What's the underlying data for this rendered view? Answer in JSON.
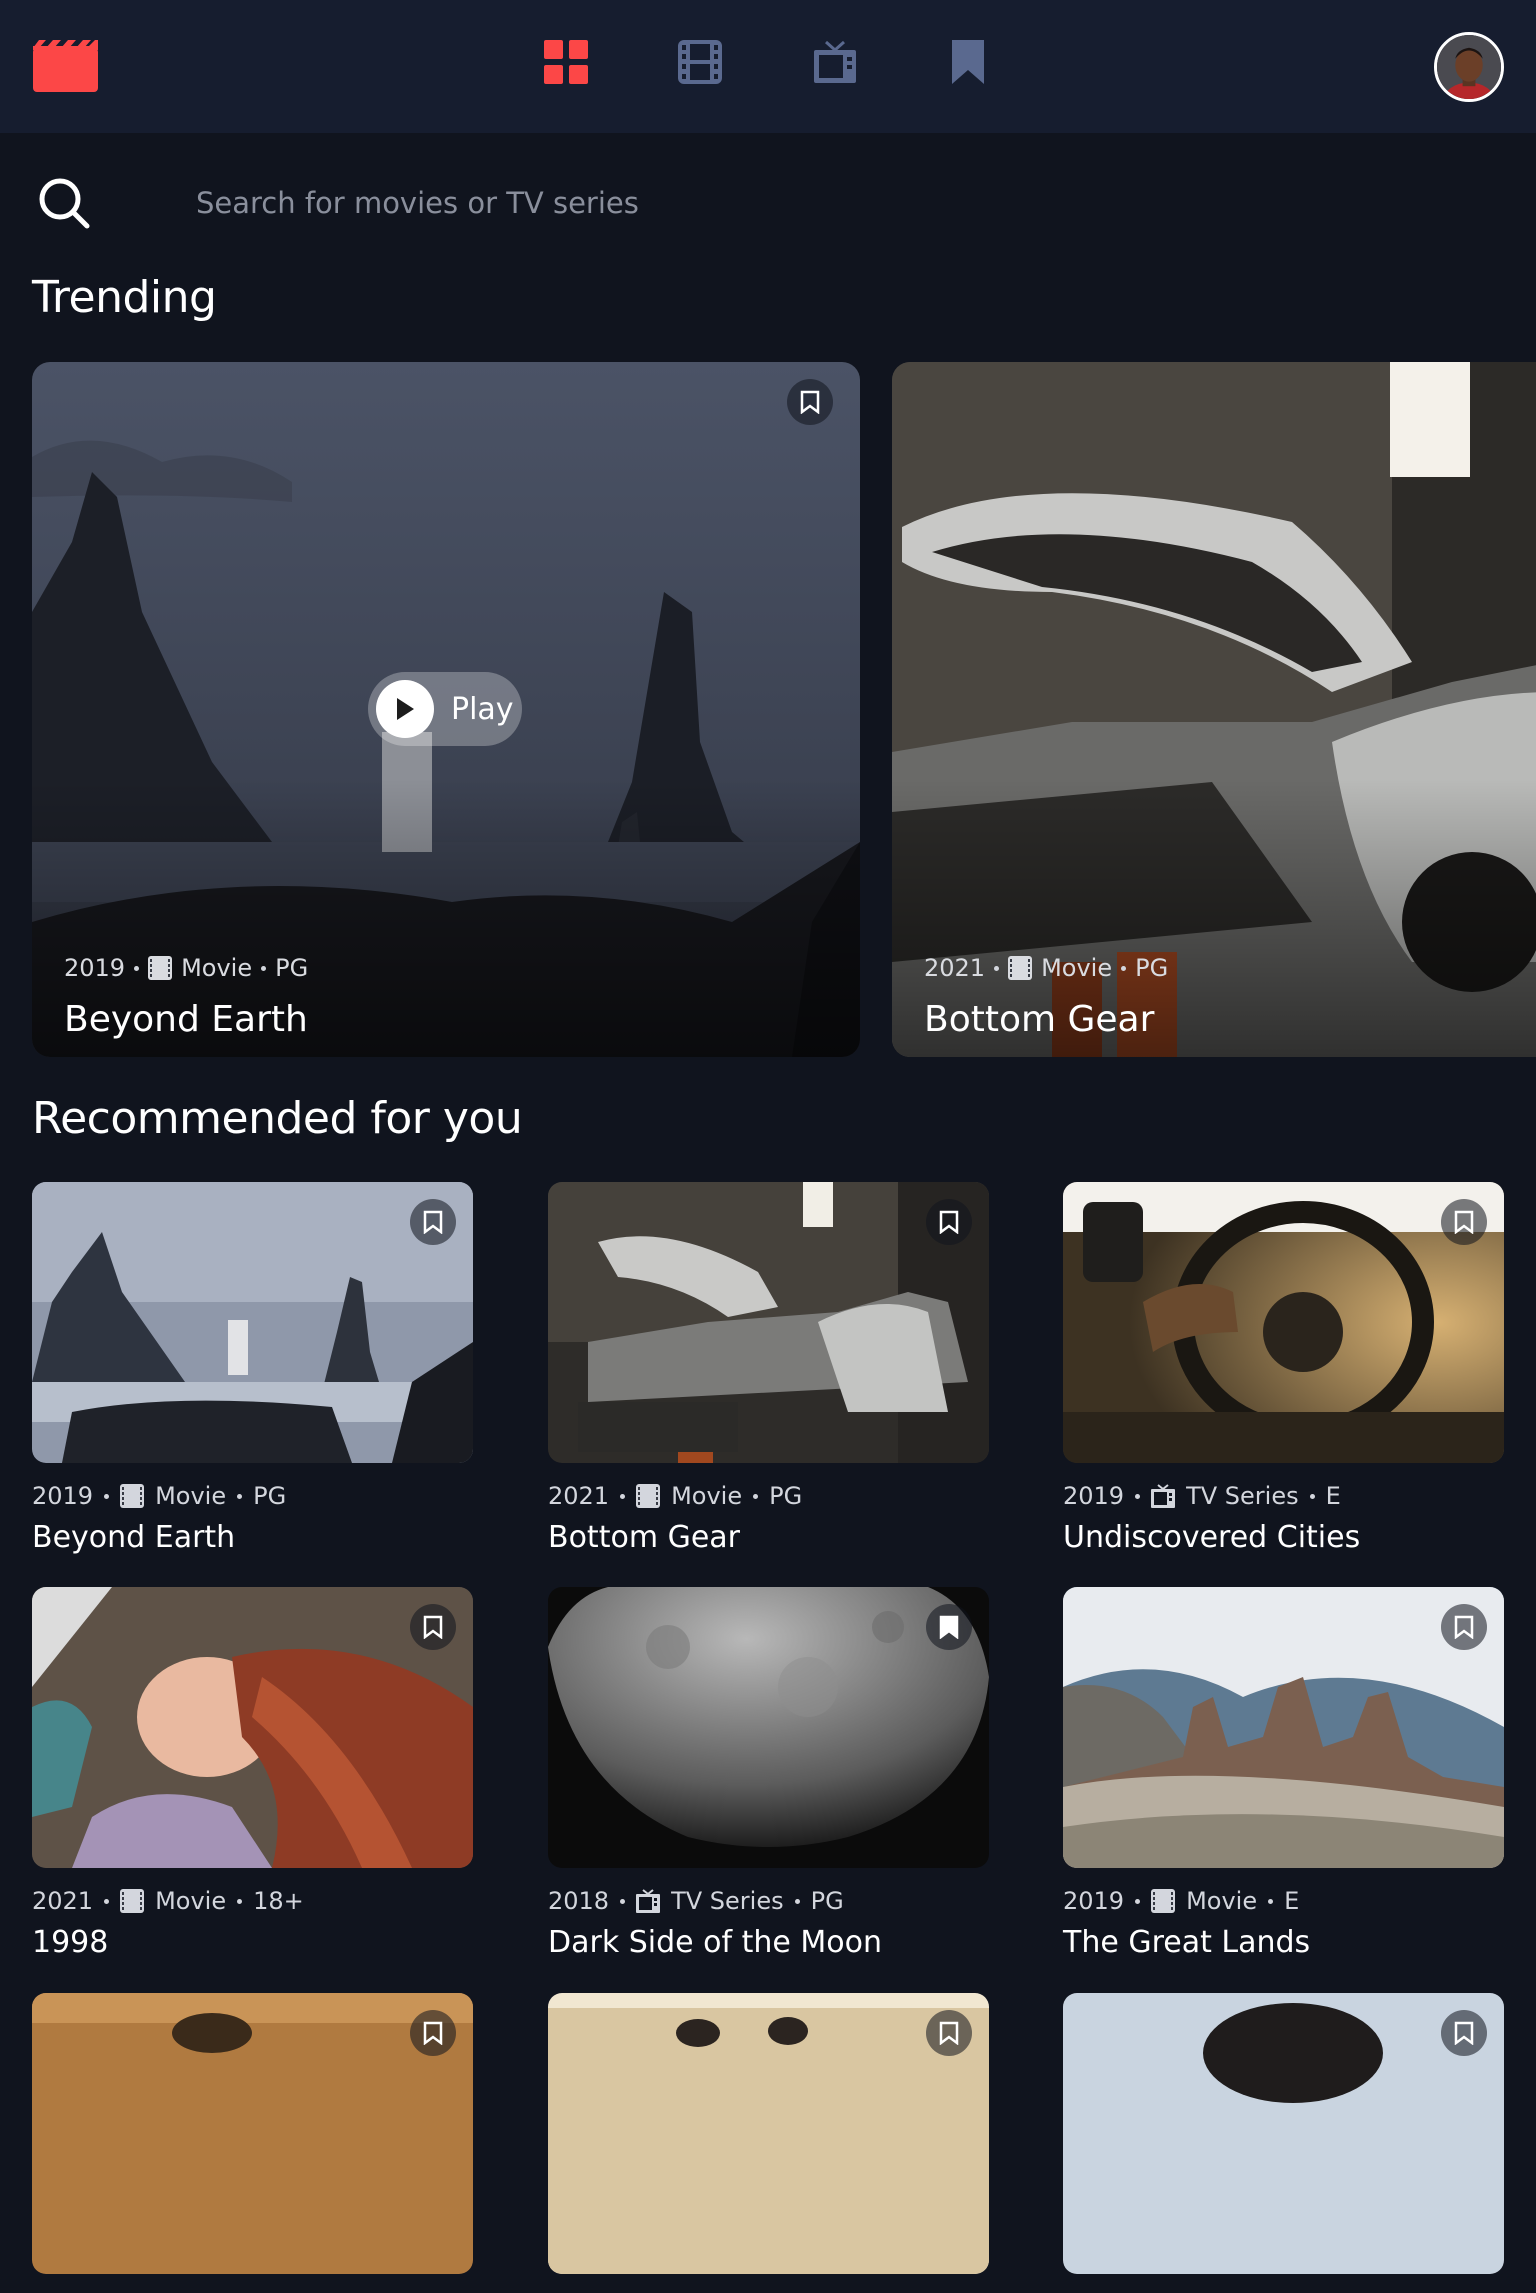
{
  "nav": {
    "logo_icon": "clapperboard-icon",
    "items": [
      {
        "icon": "grid-icon",
        "label": "Home",
        "active": true
      },
      {
        "icon": "film-icon",
        "label": "Movies",
        "active": false
      },
      {
        "icon": "tv-icon",
        "label": "TV Series",
        "active": false
      },
      {
        "icon": "bookmark-icon",
        "label": "Bookmarked",
        "active": false
      }
    ],
    "avatar_icon": "user-avatar"
  },
  "colors": {
    "background": "#10141e",
    "surface": "#161d2f",
    "accent": "#fc4747",
    "nav_inactive": "#5a698f",
    "text": "#ffffff"
  },
  "search": {
    "placeholder": "Search for movies or TV series",
    "value": ""
  },
  "trending": {
    "heading": "Trending",
    "play_label": "Play",
    "items": [
      {
        "year": "2019",
        "category": "Movie",
        "rating": "PG",
        "title": "Beyond Earth",
        "bookmarked": false
      },
      {
        "year": "2021",
        "category": "Movie",
        "rating": "PG",
        "title": "Bottom Gear",
        "bookmarked": false
      }
    ]
  },
  "recommended": {
    "heading": "Recommended for you",
    "items": [
      {
        "year": "2019",
        "category": "Movie",
        "rating": "PG",
        "title": "Beyond Earth",
        "bookmarked": false
      },
      {
        "year": "2021",
        "category": "Movie",
        "rating": "PG",
        "title": "Bottom Gear",
        "bookmarked": false
      },
      {
        "year": "2019",
        "category": "TV Series",
        "rating": "E",
        "title": "Undiscovered Cities",
        "bookmarked": false
      },
      {
        "year": "2021",
        "category": "Movie",
        "rating": "18+",
        "title": "1998",
        "bookmarked": false
      },
      {
        "year": "2018",
        "category": "TV Series",
        "rating": "PG",
        "title": "Dark Side of the Moon",
        "bookmarked": true
      },
      {
        "year": "2019",
        "category": "Movie",
        "rating": "E",
        "title": "The Great Lands",
        "bookmarked": false
      },
      {
        "bookmarked": false
      },
      {
        "bookmarked": false
      },
      {
        "bookmarked": false
      }
    ]
  }
}
